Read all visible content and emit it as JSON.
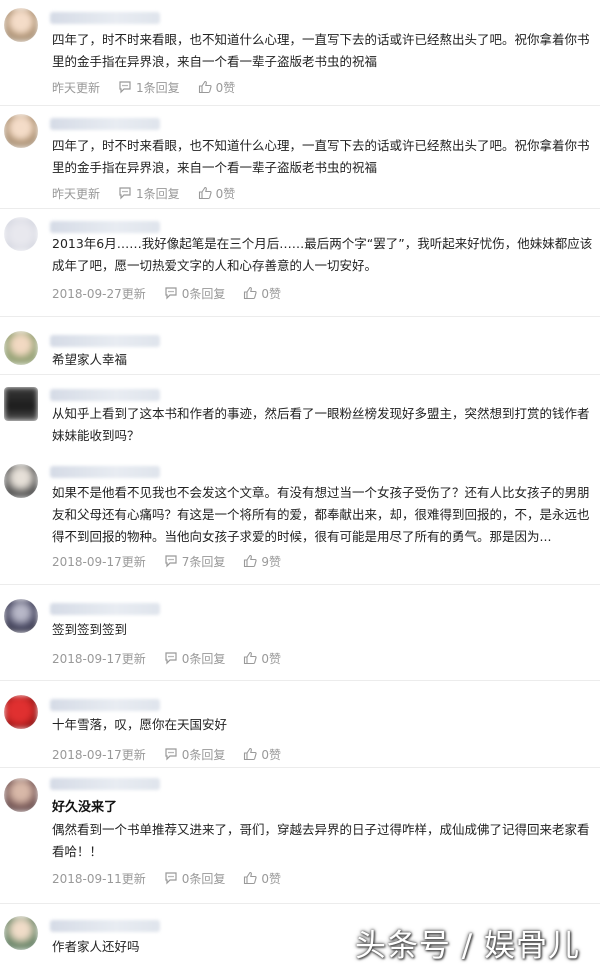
{
  "comments": [
    {
      "text": "四年了，时不时来看眼，也不知道什么心理，一直写下去的话或许已经熬出头了吧。祝你拿着你书里的金手指在异界浪，来自一个看一辈子盗版老书虫的祝福",
      "time": "昨天更新",
      "replies": "1条回复",
      "likes": "0赞"
    },
    {
      "text": "四年了，时不时来看眼，也不知道什么心理，一直写下去的话或许已经熬出头了吧。祝你拿着你书里的金手指在异界浪，来自一个看一辈子盗版老书虫的祝福",
      "time": "昨天更新",
      "replies": "1条回复",
      "likes": "0赞"
    },
    {
      "text": "2013年6月……我好像起笔是在三个月后……最后两个字“罢了”，我听起来好忧伤，他妹妹都应该成年了吧，愿一切热爱文字的人和心存善意的人一切安好。",
      "time": "2018-09-27更新",
      "replies": "0条回复",
      "likes": "0赞"
    },
    {
      "text": "希望家人幸福"
    },
    {
      "text": "从知乎上看到了这本书和作者的事迹，然后看了一眼粉丝榜发现好多盟主，突然想到打赏的钱作者妹妹能收到吗？"
    },
    {
      "text": "如果不是他看不见我也不会发这个文章。有没有想过当一个女孩子受伤了？还有人比女孩子的男朋友和父母还有心痛吗？有这是一个将所有的爱，都奉献出来，却，很难得到回报的，不，是永远也得不到回报的物种。当他向女孩子求爱的时候，很有可能是用尽了所有的勇气。那是因为...",
      "time": "2018-09-17更新",
      "replies": "7条回复",
      "likes": "9赞"
    },
    {
      "text": "签到签到签到",
      "time": "2018-09-17更新",
      "replies": "0条回复",
      "likes": "0赞"
    },
    {
      "text": "十年雪落，叹，愿你在天国安好",
      "time": "2018-09-17更新",
      "replies": "0条回复",
      "likes": "0赞"
    },
    {
      "bold": "好久没来了",
      "text": "偶然看到一个书单推荐又进来了，哥们，穿越去异界的日子过得咋样，成仙成佛了记得回来老家看看哈！！",
      "time": "2018-09-11更新",
      "replies": "0条回复",
      "likes": "0赞"
    },
    {
      "text": "作者家人还好吗"
    }
  ],
  "watermark": "头条号 / 娱骨儿",
  "colors": {
    "meta": "#999999",
    "divider": "#ececec",
    "text": "#222222"
  }
}
